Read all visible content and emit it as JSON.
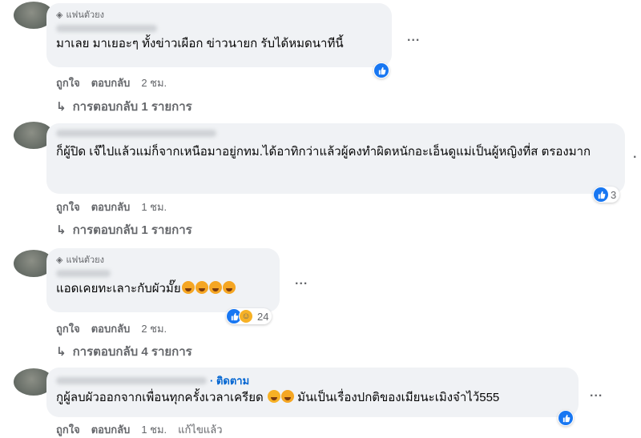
{
  "fan_label": "แฟนตัวยง",
  "comments": [
    {
      "text": "มาเลย มาเยอะๆ ทั้งข่าวเผือก ข่าวนายก รับได้หมดนาทีนี้",
      "like_label": "ถูกใจ",
      "reply_label": "ตอบกลับ",
      "time": "2 ชม.",
      "replies": "การตอบกลับ 1 รายการ",
      "reaction_count": ""
    },
    {
      "text": "ก็ผู้ปิด เจ๊ไปแล้วแม่ก็จากเหนือมาอยู่กทม.ได้อาทิกว่าแล้วผู้คงทำผิดหนักอะเอ็นดูแม่เป็นผู้หญิงที่ส ตรองมาก",
      "like_label": "ถูกใจ",
      "reply_label": "ตอบกลับ",
      "time": "1 ชม.",
      "replies": "การตอบกลับ 1 รายการ",
      "reaction_count": "3"
    },
    {
      "text": "แอดเคยทะเลาะกับผัวมั๊ย",
      "like_label": "ถูกใจ",
      "reply_label": "ตอบกลับ",
      "time": "2 ชม.",
      "replies": "การตอบกลับ 4 รายการ",
      "reaction_count": "24"
    },
    {
      "follow": "· ติดตาม",
      "text_a": "กูผู้ลบผัวออกจากเพื่อนทุกครั้งเวลาเครียด",
      "text_b": "มันเป็นเรื่องปกติของเมียนะเมิงจ๋าไว้555",
      "like_label": "ถูกใจ",
      "reply_label": "ตอบกลับ",
      "time": "1 ชม.",
      "extra": "แก้ไขแล้ว"
    }
  ],
  "more_label": "...",
  "reply_arrow": "↳",
  "icons": [
    "diamond-icon",
    "like-icon",
    "haha-icon",
    "more-icon"
  ],
  "colors": {
    "bubble": "#f0f2f5",
    "like": "#1877f2",
    "follow": "#0064d1",
    "meta": "#65676b"
  }
}
